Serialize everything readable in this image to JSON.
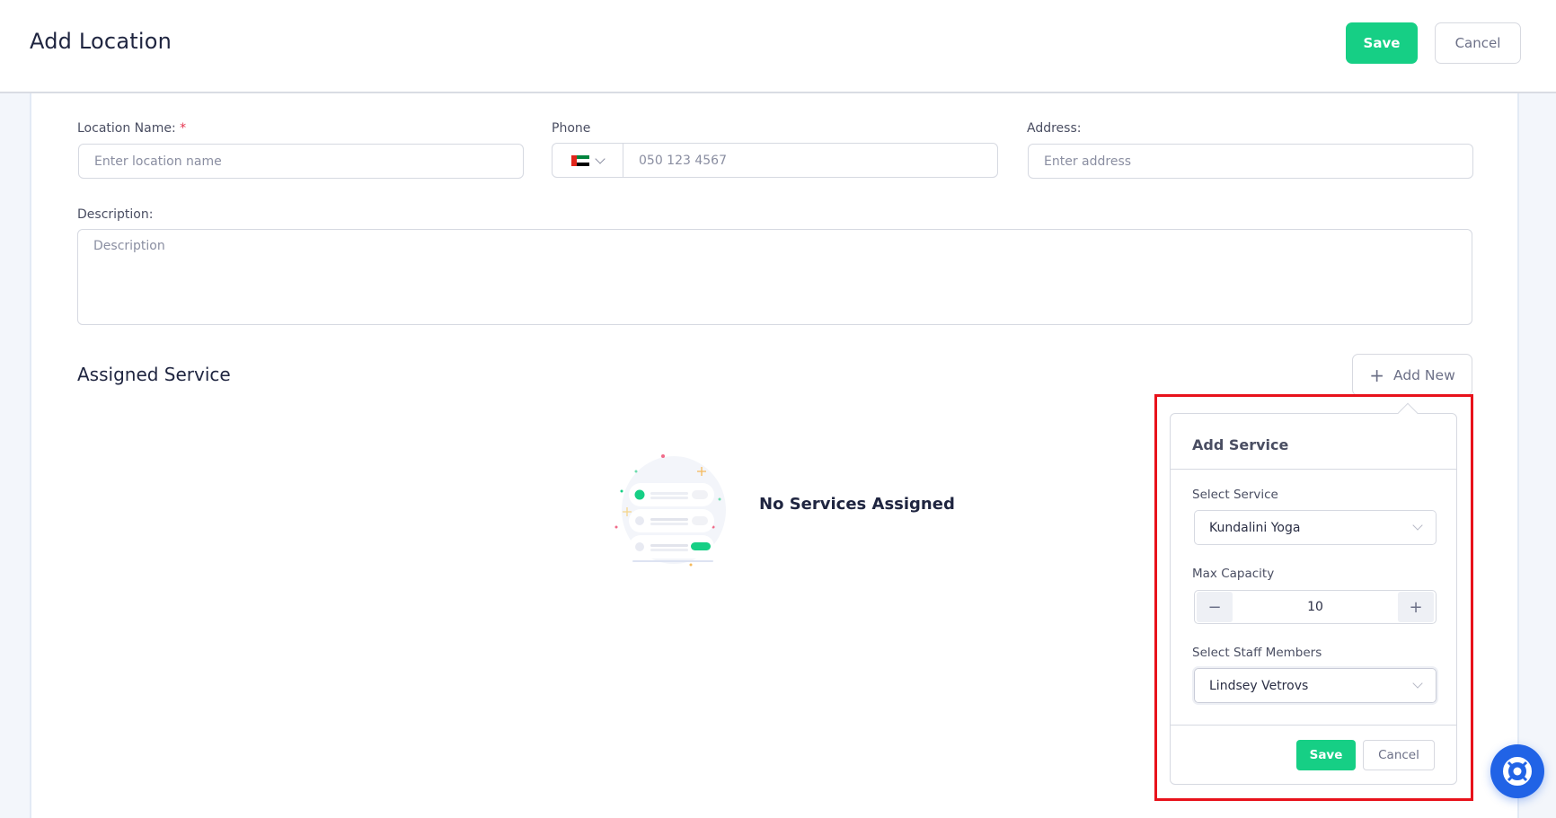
{
  "header": {
    "title": "Add Location",
    "save_label": "Save",
    "cancel_label": "Cancel"
  },
  "form": {
    "location_name": {
      "label": "Location Name:",
      "required_mark": "*",
      "placeholder": "Enter location name",
      "value": ""
    },
    "phone": {
      "label": "Phone",
      "country": "AE",
      "country_icon": "uae-flag-icon",
      "placeholder": "050 123 4567",
      "value": ""
    },
    "address": {
      "label": "Address:",
      "placeholder": "Enter address",
      "value": ""
    },
    "description": {
      "label": "Description:",
      "placeholder": "Description",
      "value": ""
    }
  },
  "assigned_service": {
    "title": "Assigned Service",
    "add_new_label": "Add New",
    "add_new_icon": "plus-icon",
    "empty_text": "No Services Assigned"
  },
  "add_service_popover": {
    "title": "Add Service",
    "select_service": {
      "label": "Select Service",
      "value": "Kundalini Yoga"
    },
    "max_capacity": {
      "label": "Max Capacity",
      "value": "10",
      "decrement": "−",
      "increment": "+"
    },
    "staff": {
      "label": "Select Staff Members",
      "value": "Lindsey Vetrovs"
    },
    "save_label": "Save",
    "cancel_label": "Cancel"
  },
  "colors": {
    "primary": "#16cf85",
    "highlight": "#e8121b",
    "help_button": "#2163e6"
  },
  "help_button": {
    "icon": "lifebuoy-icon"
  }
}
